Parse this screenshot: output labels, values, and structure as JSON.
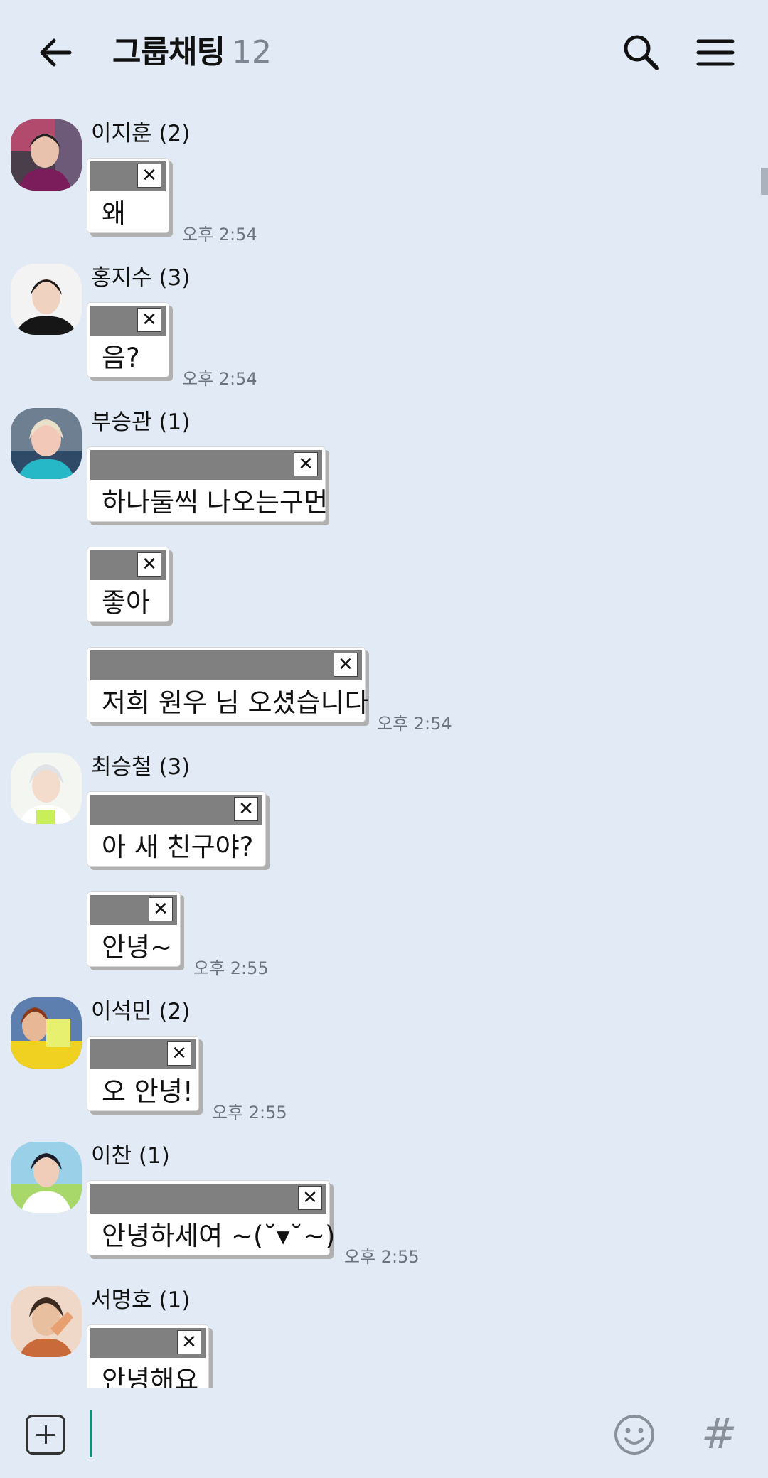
{
  "header": {
    "title": "그룹채팅",
    "member_count": "12"
  },
  "input": {
    "placeholder": ""
  },
  "colors": {
    "background": "#e2ebf5",
    "caret": "#1d8a7a",
    "bubble_bar": "#808080"
  },
  "messages": [
    {
      "sender": "이지훈 (2)",
      "bubbles": [
        "왜"
      ],
      "time": "오후 2:54"
    },
    {
      "sender": "홍지수 (3)",
      "bubbles": [
        "음?"
      ],
      "time": "오후 2:54"
    },
    {
      "sender": "부승관 (1)",
      "bubbles": [
        "하나둘씩 나오는구먼",
        "좋아",
        "저희 원우 님 오셨습니다"
      ],
      "time": "오후 2:54"
    },
    {
      "sender": "최승철 (3)",
      "bubbles": [
        "아 새 친구야?",
        "안녕~"
      ],
      "time": "오후 2:55"
    },
    {
      "sender": "이석민 (2)",
      "bubbles": [
        "오 안녕!"
      ],
      "time": "오후 2:55"
    },
    {
      "sender": "이찬 (1)",
      "bubbles": [
        "안녕하세여 ~(˘▾˘~)"
      ],
      "time": "오후 2:55"
    },
    {
      "sender": "서명호 (1)",
      "bubbles": [
        "안녕해요"
      ],
      "time": ""
    }
  ]
}
